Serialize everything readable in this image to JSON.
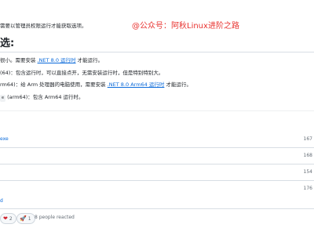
{
  "release": {
    "admin_note": "需要以管理员权限运行才能获取选项。",
    "watermark": "@公众号：阿秋Linux进阶之路",
    "section_title": "选:",
    "lines": [
      {
        "pre": "很小。需要安装 ",
        "link": ".NET 8.0 运行时",
        "post": " 才能运行。"
      },
      {
        "pre": "(64)：包含运行时，可以直接点开，无需安装运行时，但是特别特别大。",
        "link": "",
        "post": ""
      },
      {
        "pre": "rm64)：给 Arm 处理器的电脑使用，需要安装 ",
        "link": ".NET 8.0 Arm64 运行时",
        "post": " 才能运行。"
      },
      {
        "code": "e",
        "pre": " (arm64)：包含 Arm64 运行时。",
        "link": "",
        "post": ""
      }
    ]
  },
  "assets": {
    "rows": [
      {
        "name": "exe",
        "size": "167"
      },
      {
        "name": "",
        "size": "168"
      },
      {
        "name": "",
        "size": "154"
      },
      {
        "name": "",
        "size": "176"
      }
    ],
    "show_all": "d"
  },
  "reactions": {
    "items": [
      {
        "icon": "heart-icon",
        "glyph": "❤",
        "count": "2"
      },
      {
        "icon": "rocket-icon",
        "glyph": "🚀",
        "count": "1"
      }
    ],
    "summary": "8 people reacted"
  }
}
